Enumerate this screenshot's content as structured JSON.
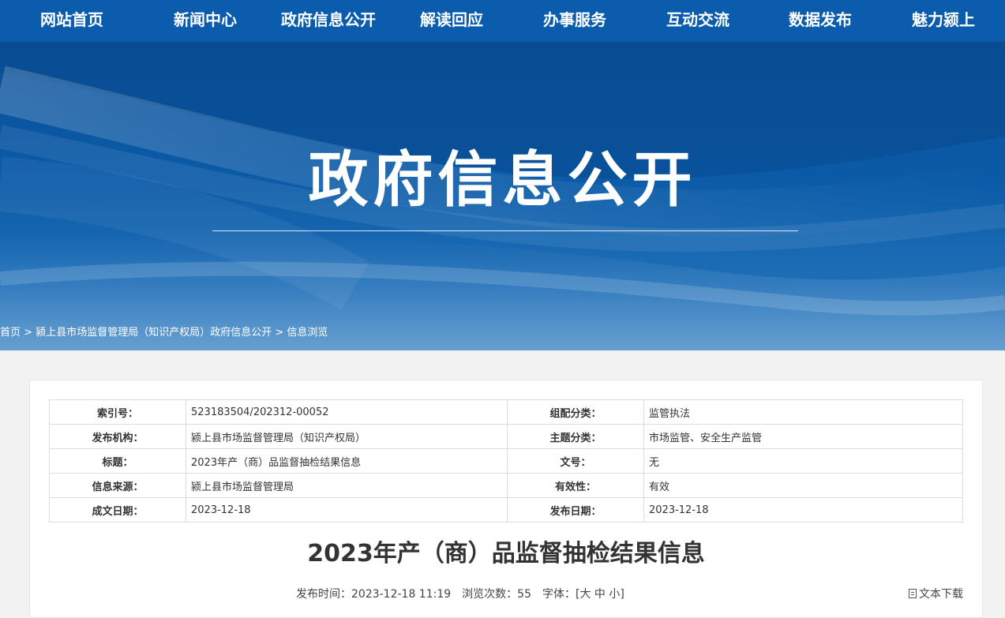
{
  "nav": {
    "items": [
      "网站首页",
      "新闻中心",
      "政府信息公开",
      "解读回应",
      "办事服务",
      "互动交流",
      "数据发布",
      "魅力颍上"
    ]
  },
  "banner": {
    "title": "政府信息公开"
  },
  "breadcrumb": {
    "home": "首页",
    "sep": ">",
    "section": "颍上县市场监督管理局（知识产权局）政府信息公开",
    "current": "信息浏览"
  },
  "info_table": {
    "rows": [
      {
        "label1": "索引号：",
        "value1": "523183504/202312-00052",
        "label2": "组配分类：",
        "value2": "监管执法"
      },
      {
        "label1": "发布机构：",
        "value1": "颍上县市场监督管理局（知识产权局）",
        "label2": "主题分类：",
        "value2": "市场监管、安全生产监管"
      },
      {
        "label1": "标题：",
        "value1": "2023年产（商）品监督抽检结果信息",
        "label2": "文号：",
        "value2": "无"
      },
      {
        "label1": "信息来源：",
        "value1": "颍上县市场监督管理局",
        "label2": "有效性：",
        "value2": "有效"
      },
      {
        "label1": "成文日期：",
        "value1": "2023-12-18",
        "label2": "发布日期：",
        "value2": "2023-12-18"
      }
    ]
  },
  "article": {
    "title": "2023年产（商）品监督抽检结果信息",
    "publish_label": "发布时间：",
    "publish_time": "2023-12-18 11:19",
    "views_label": "浏览次数：",
    "views": "55",
    "font_label": "字体：",
    "font_open": "[",
    "font_large": "大",
    "font_medium": "中",
    "font_small": "小",
    "font_close": "]",
    "download_label": "文本下载"
  },
  "colors": {
    "nav_bg": "#0b5cad",
    "banner_bg": "#0b5ba8",
    "page_bg": "#f2f2f2"
  }
}
